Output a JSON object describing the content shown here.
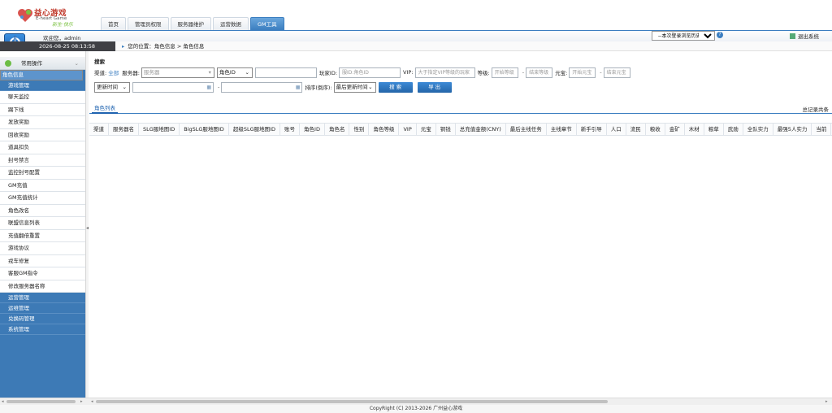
{
  "brand": {
    "name_cn": "益心游戏",
    "name_en": "E-heart Game",
    "slogan": "新生·快乐"
  },
  "nav": {
    "tabs": [
      "首页",
      "管理员权限",
      "服务器维护",
      "运营数据",
      "GM工具"
    ],
    "active": "GM工具"
  },
  "header": {
    "welcome": "欢迎您，admin",
    "history_select": "--本次登录浏览历史--",
    "logout": "退出系统",
    "datetime": "2026-08-25 08:13:58",
    "breadcrumb_prefix": "您的位置：",
    "breadcrumb": "角色信息 > 角色信息"
  },
  "sidebar": {
    "section": "常用操作",
    "groups_top": [
      {
        "label": "角色信息",
        "selected": true
      },
      {
        "label": "游戏管理",
        "selected": false
      }
    ],
    "items": [
      "聊天监控",
      "踢下线",
      "发放奖励",
      "回收奖励",
      "道具扣负",
      "封号禁言",
      "监控封号配置",
      "GM充值",
      "GM充值统计",
      "角色改名",
      "联盟信息列表",
      "充值翻倍重置",
      "游戏协议",
      "戎车修复",
      "客服GM指令",
      "修改服务器名称"
    ],
    "groups_bottom": [
      "运营管理",
      "运维管理",
      "兑换码管理",
      "系统管理"
    ]
  },
  "search": {
    "title": "搜索",
    "channel_label": "渠道:",
    "channel_value": "全部",
    "server_label": "服务器:",
    "server_placeholder": "服务器",
    "role_select": "角色ID",
    "player_label": "玩家ID:",
    "player_placeholder": "服ID:角色ID",
    "vip_label": "VIP:",
    "vip_placeholder": "大于指定VIP等级的玩家",
    "level_label": "等级:",
    "level_start": "开始等级",
    "level_end": "结束等级",
    "yuanbao_label": "元宝:",
    "yuanbao_start": "开始元宝",
    "yuanbao_end": "结束元宝",
    "time_select": "更新时间",
    "sort_label": "排序(倒序):",
    "sort_select": "最后更新时间",
    "search_button": "搜 索",
    "export_button": "导 出"
  },
  "list": {
    "tab": "角色列表",
    "total": "总记录共条",
    "columns": [
      "渠道",
      "服务器名",
      "SLG服地图ID",
      "BigSLG服地图ID",
      "超级SLG服地图ID",
      "账号",
      "角色ID",
      "角色名",
      "性别",
      "角色等级",
      "VIP",
      "元宝",
      "铜钱",
      "总充值金额(CNY)",
      "最后主线任务",
      "主线章节",
      "新手引导",
      "人口",
      "流民",
      "粮收",
      "金矿",
      "木材",
      "粮草",
      "武勋",
      "全队实力",
      "最强5人实力",
      "当前"
    ]
  },
  "footer": {
    "copyright": "CopyRight (C) 2013-2026 广州益心游戏"
  },
  "colors": {
    "accent": "#3b7ec0",
    "sidebar": "#3d7ab6",
    "brand_red": "#c0392b"
  }
}
